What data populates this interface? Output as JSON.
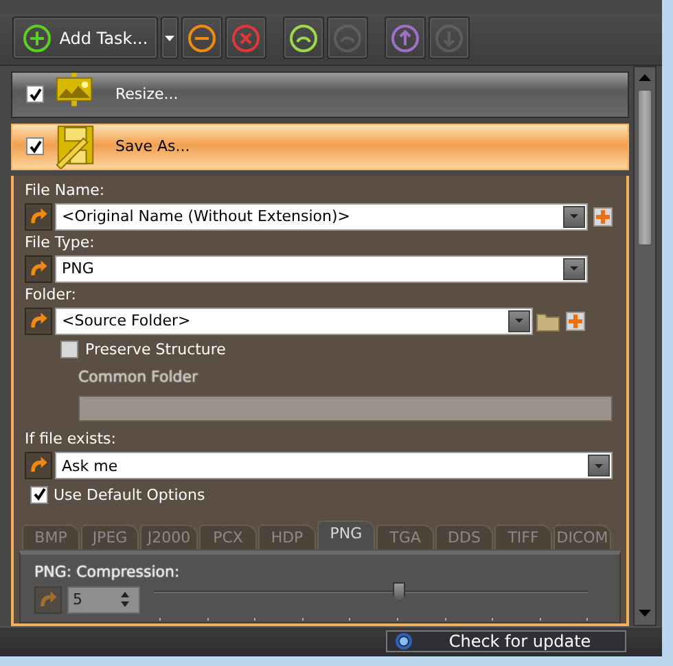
{
  "toolbar": {
    "add_button": {
      "label": "Add Task..."
    },
    "buttons": [
      {
        "kind": "dropdown",
        "disabled": false
      },
      {
        "kind": "remove",
        "disabled": false
      },
      {
        "kind": "clear",
        "disabled": false
      },
      {
        "kind": "collapse",
        "disabled": false
      },
      {
        "kind": "expand",
        "disabled": true
      },
      {
        "kind": "up",
        "disabled": false
      },
      {
        "kind": "down",
        "disabled": true
      }
    ]
  },
  "tasks": [
    {
      "kind": "resize",
      "title": "Resize...",
      "checked": true,
      "selected": false
    },
    {
      "kind": "save",
      "title": "Save As...",
      "checked": true,
      "selected": true
    }
  ],
  "save_as": {
    "fields": [
      {
        "label": "File Name:",
        "value": "<Original Name (Without Extension)>",
        "folder_button": false,
        "add_button": true
      },
      {
        "label": "File Type:",
        "value": "PNG",
        "folder_button": false,
        "add_button": false
      },
      {
        "label": "Folder:",
        "value": "<Source Folder>",
        "folder_button": true,
        "add_button": true
      }
    ],
    "preserve_structure": {
      "label": "Preserve Structure",
      "checked": false
    },
    "common_folder": {
      "label": "Common Folder",
      "disabled": true
    },
    "if_exists": {
      "label": "If file exists:",
      "value": "Ask me"
    },
    "use_default_options": {
      "label": "Use Default Options",
      "checked": true
    },
    "format_tabs": [
      {
        "label": "BMP",
        "selected": false
      },
      {
        "label": "JPEG",
        "selected": false
      },
      {
        "label": "J2000",
        "selected": false
      },
      {
        "label": "PCX",
        "selected": false
      },
      {
        "label": "HDP",
        "selected": false
      },
      {
        "label": "PNG",
        "selected": true
      },
      {
        "label": "TGA",
        "selected": false
      },
      {
        "label": "DDS",
        "selected": false
      },
      {
        "label": "TIFF",
        "selected": false
      },
      {
        "label": "DICOM",
        "selected": false
      }
    ],
    "compression": {
      "label": "PNG: Compression:",
      "value": "5",
      "level": 0.56
    }
  },
  "status_bar": {
    "update_button": "Check for update"
  }
}
